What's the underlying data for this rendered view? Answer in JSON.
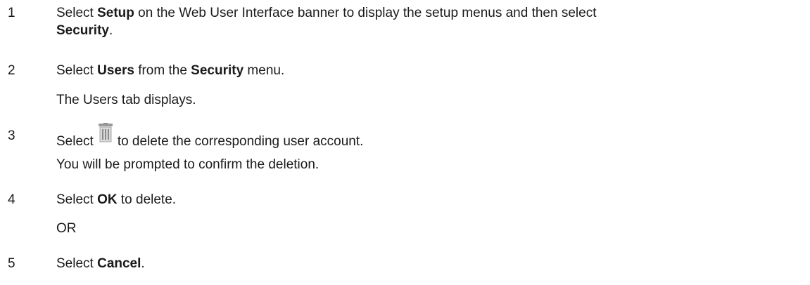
{
  "steps": [
    {
      "number": "1",
      "parts": {
        "a": "Select ",
        "b": "Setup",
        "c": " on the Web User Interface banner to display the setup menus and then select",
        "d": "Security",
        "e": "."
      }
    },
    {
      "number": "2",
      "parts": {
        "a": "Select ",
        "b": "Users",
        "c": " from the ",
        "d": "Security",
        "e": " menu."
      },
      "note": "The Users tab displays."
    },
    {
      "number": "3",
      "parts": {
        "a": "Select",
        "icon": "trash-icon",
        "c": "to delete the corresponding user account."
      },
      "note": "You will be prompted to confirm the deletion."
    },
    {
      "number": "4",
      "parts": {
        "a": "Select ",
        "b": "OK",
        "c": " to delete."
      },
      "note": "OR"
    },
    {
      "number": "5",
      "parts": {
        "a": "Select ",
        "b": "Cancel",
        "c": "."
      }
    }
  ],
  "colors": {
    "text": "#1a1a1a",
    "trash_light": "#d9d9d9",
    "trash_dark": "#8c8c8c"
  }
}
